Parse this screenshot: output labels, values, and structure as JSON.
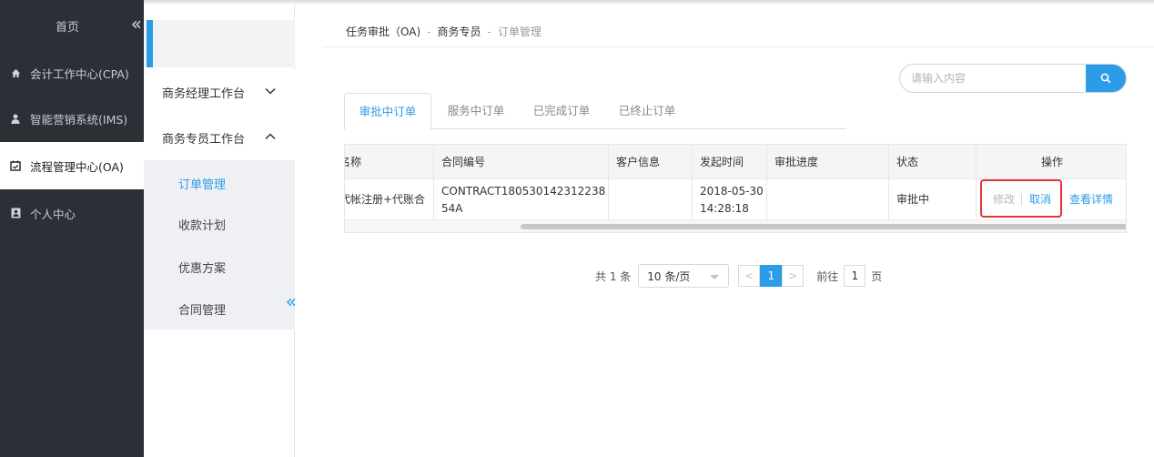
{
  "sidebar": {
    "home_label": "首页",
    "collapse_glyph": "«",
    "items": [
      {
        "icon": "home-icon",
        "label": "会计工作中心(CPA)"
      },
      {
        "icon": "user-icon",
        "label": "智能营销系统(IMS)"
      },
      {
        "icon": "calendar-check-icon",
        "label": "流程管理中心(OA)",
        "active": true
      },
      {
        "icon": "contact-card-icon",
        "label": "个人中心"
      }
    ]
  },
  "subnav": {
    "groups": [
      {
        "label": "商务经理工作台",
        "expanded": false
      },
      {
        "label": "商务专员工作台",
        "expanded": true
      }
    ],
    "links": [
      "订单管理",
      "收款计划",
      "优惠方案",
      "合同管理"
    ],
    "active_link": "订单管理",
    "collapse_glyph": "«"
  },
  "breadcrumb": {
    "items": [
      "任务审批（OA)",
      "商务专员",
      "订单管理"
    ],
    "separator": "-"
  },
  "search": {
    "placeholder": "请输入内容",
    "value": ""
  },
  "tabs": [
    {
      "label": "审批中订单",
      "active": true
    },
    {
      "label": "服务中订单"
    },
    {
      "label": "已完成订单"
    },
    {
      "label": "已终止订单"
    }
  ],
  "table": {
    "columns": [
      "名称",
      "合同编号",
      "客户信息",
      "发起时间",
      "审批进度",
      "状态",
      "操作"
    ],
    "rows": [
      {
        "name": "代帐注册+代账合",
        "contract_no": "CONTRACT18053014231223854A",
        "customer": "",
        "start_time": "2018-05-30 14:28:18",
        "progress": "",
        "status": "审批中",
        "actions": {
          "edit": "修改",
          "cancel": "取消",
          "detail": "查看详情"
        }
      }
    ]
  },
  "pagination": {
    "total_text": "共 1 条",
    "page_size": "10 条/页",
    "prev_glyph": "<",
    "next_glyph": ">",
    "current_page": "1",
    "goto_label": "前往",
    "goto_value": "1",
    "page_unit": "页"
  },
  "colors": {
    "accent": "#2b9ce8",
    "sidebar_bg": "#2d2f36",
    "highlight_box": "#e53333"
  }
}
